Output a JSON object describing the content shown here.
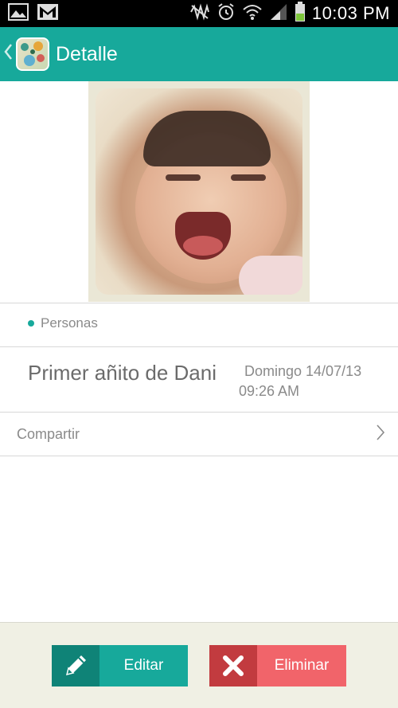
{
  "status_bar": {
    "time": "10:03 PM",
    "icons": [
      "gallery-icon",
      "gmail-icon",
      "mute-icon",
      "alarm-icon",
      "wifi-icon",
      "signal-icon",
      "battery-icon"
    ]
  },
  "action_bar": {
    "title": "Detalle",
    "back_icon": "chevron-left-icon",
    "app_icon": "app-icon"
  },
  "detail": {
    "personas_label": "Personas",
    "event_title": "Primer añito de Dani",
    "event_date": "Domingo 14/07/13",
    "event_time": "09:26 AM",
    "share_label": "Compartir"
  },
  "buttons": {
    "edit_label": "Editar",
    "delete_label": "Eliminar"
  },
  "colors": {
    "accent": "#17a99b",
    "accent_dark": "#0f8377",
    "danger": "#f1646a",
    "danger_dark": "#c23b3f",
    "bottom_bar": "#f0f0e4"
  }
}
